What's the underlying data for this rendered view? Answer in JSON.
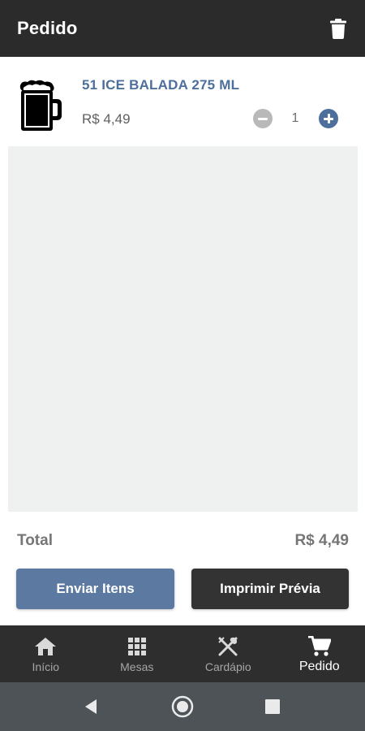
{
  "header": {
    "title": "Pedido",
    "trash_icon": "trash-icon"
  },
  "order_item": {
    "name": "51 ICE BALADA 275 ML",
    "price": "R$ 4,49",
    "quantity": "1",
    "image_icon": "beer-mug-icon"
  },
  "summary": {
    "total_label": "Total",
    "total_value": "R$ 4,49"
  },
  "actions": {
    "send_label": "Enviar Itens",
    "print_label": "Imprimir Prévia"
  },
  "nav": {
    "items": [
      {
        "label": "Início",
        "icon": "home-icon"
      },
      {
        "label": "Mesas",
        "icon": "grid-icon"
      },
      {
        "label": "Cardápio",
        "icon": "utensils-icon"
      },
      {
        "label": "Pedido",
        "icon": "cart-icon"
      }
    ],
    "active": "Pedido"
  },
  "colors": {
    "header_bg": "#2b2b2b",
    "accent": "#5c7aa1",
    "item_name": "#4d6f9c",
    "nav_bg": "#2e2e2e",
    "system_bar_bg": "#4d5356"
  }
}
